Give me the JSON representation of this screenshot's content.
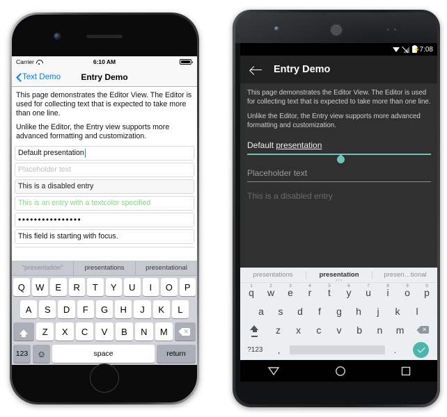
{
  "ios": {
    "status": {
      "carrier": "Carrier",
      "wifi_icon": "wifi-icon",
      "time": "6:10 AM",
      "battery_icon": "battery-full-icon"
    },
    "nav": {
      "back_label": "Text Demo",
      "back_icon": "chevron-left-icon",
      "title": "Entry Demo"
    },
    "paragraphs": [
      "This page demonstrates the Editor View. The Editor is used for collecting text that is expected to take more than one line.",
      "Unlike the Editor, the Entry view supports more advanced formatting and customization."
    ],
    "fields": [
      {
        "name": "default-presentation",
        "value": "Default presentation",
        "placeholder": "",
        "state": "focused"
      },
      {
        "name": "placeholder-entry",
        "value": "",
        "placeholder": "Placeholder text",
        "state": "placeholder"
      },
      {
        "name": "disabled-entry",
        "value": "This is a disabled entry",
        "placeholder": "",
        "state": "disabled"
      },
      {
        "name": "textcolor-entry",
        "value": "This is an entry with a textcolor specified",
        "placeholder": "",
        "state": "green"
      },
      {
        "name": "password-entry",
        "value": "••••••••••••••••",
        "placeholder": "",
        "state": "password"
      },
      {
        "name": "focus-entry",
        "value": "This field is starting with focus.",
        "placeholder": "",
        "state": "normal"
      }
    ],
    "keyboard": {
      "predictions": [
        "“presentation”",
        "presentations",
        "presentational"
      ],
      "row1": [
        "Q",
        "W",
        "E",
        "R",
        "T",
        "Y",
        "U",
        "I",
        "O",
        "P"
      ],
      "row2": [
        "A",
        "S",
        "D",
        "F",
        "G",
        "H",
        "J",
        "K",
        "L"
      ],
      "row3": [
        "Z",
        "X",
        "C",
        "V",
        "B",
        "N",
        "M"
      ],
      "shift_icon": "shift-icon",
      "delete_icon": "backspace-icon",
      "numeric_label": "123",
      "emoji_icon": "emoji-icon",
      "emoji_glyph": "☺",
      "space_label": "space",
      "return_label": "return"
    }
  },
  "android": {
    "status": {
      "wifi_icon": "wifi-icon",
      "signal_icon": "signal-off-icon",
      "battery_icon": "battery-charging-icon",
      "time": "7:08"
    },
    "appbar": {
      "back_icon": "arrow-back-icon",
      "title": "Entry Demo"
    },
    "paragraphs": [
      "This page demonstrates the Editor View. The Editor is used for collecting text that is expected to take more than one line.",
      "Unlike the Editor, the Entry view supports more advanced formatting and customization."
    ],
    "fields": [
      {
        "name": "default-presentation",
        "prefix": "Default ",
        "underlined": "presentation",
        "state": "focused",
        "accent": "#6fc5b4"
      },
      {
        "name": "placeholder-entry",
        "value": "Placeholder text",
        "state": "placeholder"
      },
      {
        "name": "disabled-entry",
        "value": "This is a disabled entry",
        "state": "disabled"
      }
    ],
    "keyboard": {
      "suggestions": [
        "presentations",
        "presentation",
        "presen…tional"
      ],
      "active_suggestion_index": 1,
      "more_icon": "more-dots-icon",
      "row1": [
        "q",
        "w",
        "e",
        "r",
        "t",
        "y",
        "u",
        "i",
        "o",
        "p"
      ],
      "row1_numbers": [
        "1",
        "2",
        "3",
        "4",
        "5",
        "6",
        "7",
        "8",
        "9",
        "0"
      ],
      "row2": [
        "a",
        "s",
        "d",
        "f",
        "g",
        "h",
        "j",
        "k",
        "l"
      ],
      "row3": [
        "z",
        "x",
        "c",
        "v",
        "b",
        "n",
        "m"
      ],
      "shift_icon": "shift-icon",
      "delete_icon": "backspace-icon",
      "symbols_label": "?123",
      "comma_label": ",",
      "period_label": ".",
      "enter_icon": "check-icon",
      "enter_color": "#4db6ac"
    },
    "navbar": {
      "back_icon": "nav-back-triangle-icon",
      "home_icon": "nav-home-circle-icon",
      "recents_icon": "nav-recents-square-icon"
    }
  }
}
